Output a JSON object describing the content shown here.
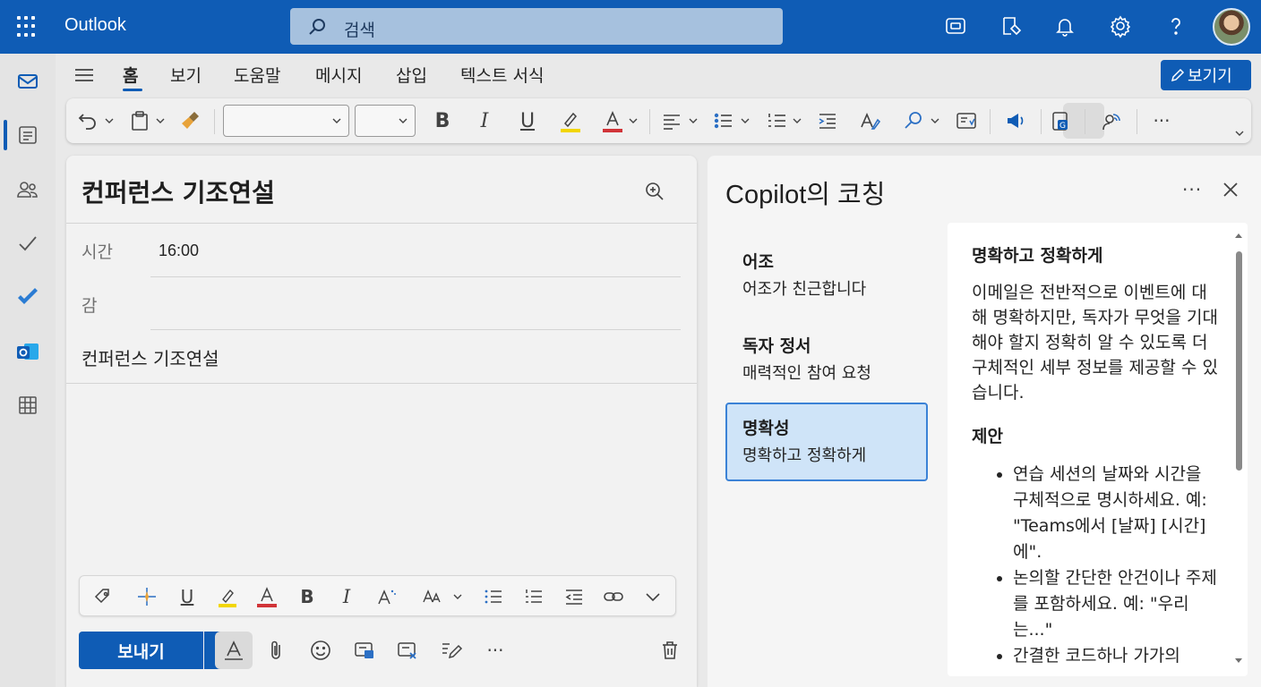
{
  "app": {
    "name": "Outlook"
  },
  "search": {
    "placeholder": "검색"
  },
  "tabs": [
    {
      "label": "홈"
    },
    {
      "label": "보기"
    },
    {
      "label": "도움말"
    },
    {
      "label": "메시지"
    },
    {
      "label": "삽입"
    },
    {
      "label": "텍스트 서식"
    }
  ],
  "view_button": {
    "label": "보기기"
  },
  "ribbon": {
    "bold": "B",
    "italic": "I",
    "underline": "U",
    "more": "···"
  },
  "compose": {
    "subject_title": "컨퍼런스 기조연설",
    "time_label": "시간",
    "time_value": "16:00",
    "place_label": "감",
    "body": "컨퍼런스 기조연설",
    "send_label": "보내기",
    "more": "···"
  },
  "copilot": {
    "title": "Copilot의 코칭",
    "more": "···",
    "items": [
      {
        "title": "어조",
        "subtitle": "어조가 친근합니다"
      },
      {
        "title": "독자 정서",
        "subtitle": "매력적인 참여 요청"
      },
      {
        "title": "명확성",
        "subtitle": "명확하고 정확하게"
      }
    ],
    "selected_index": 2,
    "detail": {
      "title": "명확하고 정확하게",
      "description": "이메일은 전반적으로 이벤트에 대해 명확하지만, 독자가 무엇을 기대해야 할지 정확히 알 수 있도록 더 구체적인 세부 정보를 제공할 수 있습니다.",
      "suggestions_title": "제안",
      "suggestions": [
        "연습 세션의 날짜와 시간을 구체적으로 명시하세요. 예: \"Teams에서 [날짜] [시간]에\".",
        "논의할 간단한 안건이나 주제를 포함하세요. 예: \"우리는...\"",
        "간결한 코드하나 가가의"
      ]
    }
  },
  "colors": {
    "brand": "#0f5cb5",
    "highlight_yellow": "#f2d600",
    "font_red": "#d13438",
    "selected_bg": "#cfe4f8"
  }
}
